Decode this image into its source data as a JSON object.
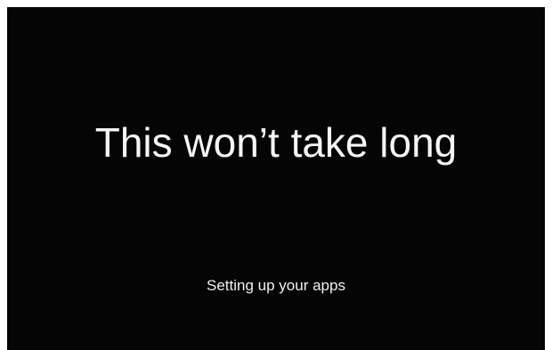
{
  "setup_screen": {
    "headline": "This won’t take long",
    "status": "Setting up your apps",
    "background_color": "#050505",
    "text_color": "#f5f5f5"
  }
}
